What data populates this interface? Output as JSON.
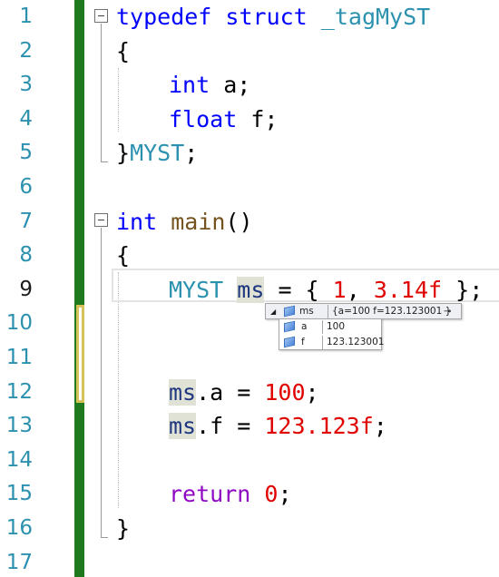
{
  "line_numbers": [
    "1",
    "2",
    "3",
    "4",
    "5",
    "6",
    "7",
    "8",
    "9",
    "10",
    "11",
    "12",
    "13",
    "14",
    "15",
    "16",
    "17"
  ],
  "active_line": "9",
  "code": {
    "l1": {
      "kw1": "typedef",
      "kw2": "struct",
      "name": "_tagMyST"
    },
    "l2": {
      "brace": "{"
    },
    "l3": {
      "type": "int",
      "rest": " a;"
    },
    "l4": {
      "type": "float",
      "rest": " f;"
    },
    "l5": {
      "brace": "}",
      "alias": "MYST",
      "semi": ";"
    },
    "l7": {
      "type": "int",
      "fn": "main",
      "paren": "()"
    },
    "l8": {
      "brace": "{"
    },
    "l9": {
      "type": "MYST",
      "var": "ms",
      "eq": " = { ",
      "n1": "1",
      "comma": ", ",
      "n2": "3.14f",
      "end": " };"
    },
    "l12": {
      "var": "ms",
      ".a = ": ".a = ",
      "num": "100",
      "semi": ";"
    },
    "l13": {
      "var": "ms",
      "mid": ".f = ",
      "num": "123.123f",
      "semi": ";"
    },
    "l15": {
      "kw": "return",
      "num": "0",
      "semi": ";"
    },
    "l16": {
      "brace": "}"
    }
  },
  "datatip": {
    "expand_glyph": "◢",
    "name": "ms",
    "value": "{a=100 f=123.123001 }",
    "pin_glyph": "⊸",
    "rows": [
      {
        "name": "a",
        "value": "100"
      },
      {
        "name": "f",
        "value": "123.123001"
      }
    ]
  }
}
